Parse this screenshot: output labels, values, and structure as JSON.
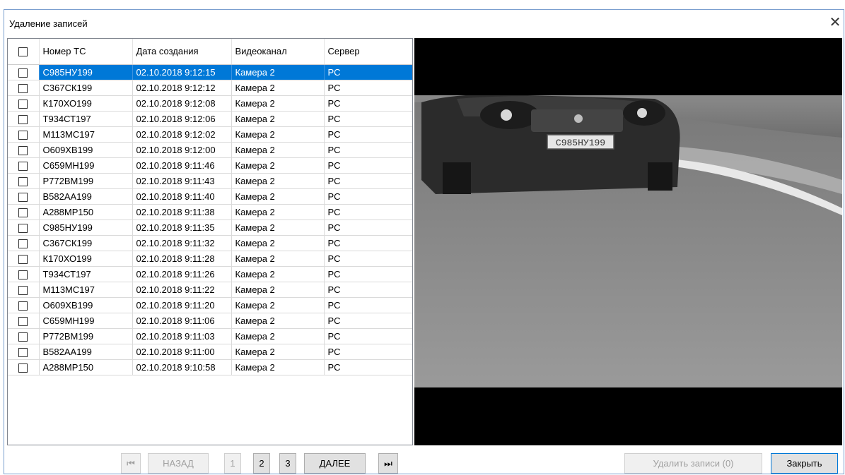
{
  "dialog": {
    "title": "Удаление записей",
    "close_glyph": "✕"
  },
  "table": {
    "columns": [
      "Номер ТС",
      "Дата создания",
      "Видеоканал",
      "Сервер"
    ],
    "selected_row_index": 0,
    "rows": [
      {
        "plate": "С985НУ199",
        "date": "02.10.2018 9:12:15",
        "channel": "Камера 2",
        "server": "PC"
      },
      {
        "plate": "С367СК199",
        "date": "02.10.2018 9:12:12",
        "channel": "Камера 2",
        "server": "PC"
      },
      {
        "plate": "К170ХО199",
        "date": "02.10.2018 9:12:08",
        "channel": "Камера 2",
        "server": "PC"
      },
      {
        "plate": "Т934СТ197",
        "date": "02.10.2018 9:12:06",
        "channel": "Камера 2",
        "server": "PC"
      },
      {
        "plate": "М113МС197",
        "date": "02.10.2018 9:12:02",
        "channel": "Камера 2",
        "server": "PC"
      },
      {
        "plate": "О609ХВ199",
        "date": "02.10.2018 9:12:00",
        "channel": "Камера 2",
        "server": "PC"
      },
      {
        "plate": "С659МН199",
        "date": "02.10.2018 9:11:46",
        "channel": "Камера 2",
        "server": "PC"
      },
      {
        "plate": "Р772ВМ199",
        "date": "02.10.2018 9:11:43",
        "channel": "Камера 2",
        "server": "PC"
      },
      {
        "plate": "В582АА199",
        "date": "02.10.2018 9:11:40",
        "channel": "Камера 2",
        "server": "PC"
      },
      {
        "plate": "А288МР150",
        "date": "02.10.2018 9:11:38",
        "channel": "Камера 2",
        "server": "PC"
      },
      {
        "plate": "С985НУ199",
        "date": "02.10.2018 9:11:35",
        "channel": "Камера 2",
        "server": "PC"
      },
      {
        "plate": "С367СК199",
        "date": "02.10.2018 9:11:32",
        "channel": "Камера 2",
        "server": "PC"
      },
      {
        "plate": "К170ХО199",
        "date": "02.10.2018 9:11:28",
        "channel": "Камера 2",
        "server": "PC"
      },
      {
        "plate": "Т934СТ197",
        "date": "02.10.2018 9:11:26",
        "channel": "Камера 2",
        "server": "PC"
      },
      {
        "plate": "М113МС197",
        "date": "02.10.2018 9:11:22",
        "channel": "Камера 2",
        "server": "PC"
      },
      {
        "plate": "О609ХВ199",
        "date": "02.10.2018 9:11:20",
        "channel": "Камера 2",
        "server": "PC"
      },
      {
        "plate": "С659МН199",
        "date": "02.10.2018 9:11:06",
        "channel": "Камера 2",
        "server": "PC"
      },
      {
        "plate": "Р772ВМ199",
        "date": "02.10.2018 9:11:03",
        "channel": "Камера 2",
        "server": "PC"
      },
      {
        "plate": "В582АА199",
        "date": "02.10.2018 9:11:00",
        "channel": "Камера 2",
        "server": "PC"
      },
      {
        "plate": "А288МР150",
        "date": "02.10.2018 9:10:58",
        "channel": "Камера 2",
        "server": "PC"
      }
    ]
  },
  "preview": {
    "plate_text": "С985НУ199"
  },
  "pagination": {
    "back_label": "НАЗАД",
    "next_label": "ДАЛЕЕ",
    "pages": [
      "1",
      "2",
      "3"
    ],
    "current_page": "1"
  },
  "actions": {
    "delete_label": "Удалить записи (0)",
    "close_label": "Закрыть"
  },
  "colors": {
    "selection": "#0078d7",
    "dialog_border": "#7a9fcf"
  }
}
